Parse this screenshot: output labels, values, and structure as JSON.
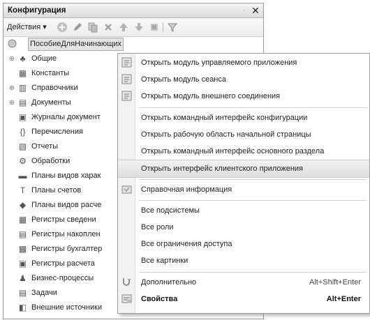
{
  "panel": {
    "title": "Конфигурация",
    "pin_glyph": "◦",
    "close_glyph": "✕"
  },
  "toolbar": {
    "actions_label": "Действия ▾",
    "icons": [
      "add-circle-icon",
      "edit-pencil-icon",
      "copy-icon",
      "delete-x-icon",
      "move-up-icon",
      "move-down-icon",
      "list-icon",
      "filter-icon"
    ]
  },
  "tree": {
    "root": "ПособиеДляНачинающих",
    "items": [
      {
        "label": "Общие",
        "icon": "general-icon",
        "expandable": true
      },
      {
        "label": "Константы",
        "icon": "constants-icon",
        "expandable": false
      },
      {
        "label": "Справочники",
        "icon": "catalogs-icon",
        "expandable": true
      },
      {
        "label": "Документы",
        "icon": "documents-icon",
        "expandable": true
      },
      {
        "label": "Журналы документ",
        "icon": "journals-icon",
        "expandable": false
      },
      {
        "label": "Перечисления",
        "icon": "enums-icon",
        "expandable": false
      },
      {
        "label": "Отчеты",
        "icon": "reports-icon",
        "expandable": false
      },
      {
        "label": "Обработки",
        "icon": "processing-icon",
        "expandable": false
      },
      {
        "label": "Планы видов харак",
        "icon": "char-types-icon",
        "expandable": false
      },
      {
        "label": "Планы счетов",
        "icon": "chart-of-accounts-icon",
        "expandable": false
      },
      {
        "label": "Планы видов расче",
        "icon": "calc-types-icon",
        "expandable": false
      },
      {
        "label": "Регистры сведени",
        "icon": "info-registers-icon",
        "expandable": false
      },
      {
        "label": "Регистры накоплен",
        "icon": "accum-registers-icon",
        "expandable": false
      },
      {
        "label": "Регистры бухгалтер",
        "icon": "accounting-registers-icon",
        "expandable": false
      },
      {
        "label": "Регистры расчета",
        "icon": "calc-registers-icon",
        "expandable": false
      },
      {
        "label": "Бизнес-процессы",
        "icon": "business-process-icon",
        "expandable": false
      },
      {
        "label": "Задачи",
        "icon": "tasks-icon",
        "expandable": false
      },
      {
        "label": "Внешние источники",
        "icon": "external-sources-icon",
        "expandable": false
      }
    ]
  },
  "menu": {
    "items": [
      {
        "label": "Открыть модуль управляемого приложения",
        "icon": "module-icon"
      },
      {
        "label": "Открыть модуль сеанса",
        "icon": "module-icon"
      },
      {
        "label": "Открыть модуль внешнего соединения",
        "icon": "module-icon"
      },
      {
        "label": "Открыть командный интерфейс конфигурации",
        "icon": ""
      },
      {
        "label": "Открыть рабочую область начальной страницы",
        "icon": ""
      },
      {
        "label": "Открыть командный интерфейс основного раздела",
        "icon": ""
      },
      {
        "label": "Открыть интерфейс клиентского приложения",
        "icon": "",
        "highlighted": true
      },
      {
        "label": "Справочная информация",
        "icon": "help-icon"
      },
      {
        "label": "Все подсистемы",
        "icon": ""
      },
      {
        "label": "Все роли",
        "icon": ""
      },
      {
        "label": "Все ограничения доступа",
        "icon": ""
      },
      {
        "label": "Все картинки",
        "icon": ""
      },
      {
        "label": "Дополнительно",
        "icon": "advanced-icon",
        "shortcut": "Alt+Shift+Enter"
      },
      {
        "label": "Свойства",
        "icon": "properties-icon",
        "shortcut": "Alt+Enter",
        "bold": true
      }
    ]
  }
}
